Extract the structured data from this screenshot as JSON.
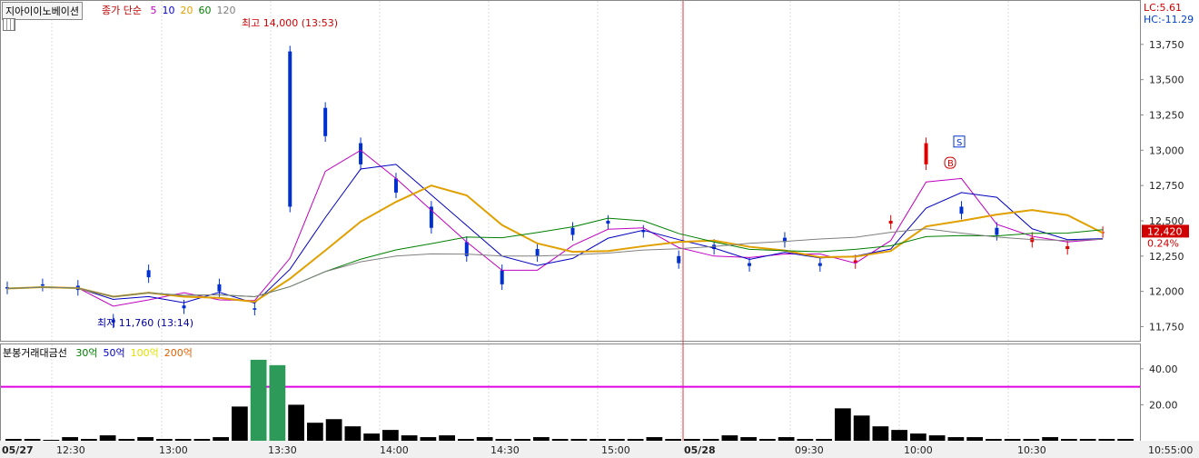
{
  "stock_name": "지아이이노베이션",
  "price_legend": {
    "label": "종가 단순",
    "periods": [
      {
        "text": "5",
        "color": "#c000c0"
      },
      {
        "text": "10",
        "color": "#0000c0"
      },
      {
        "text": "20",
        "color": "#e0a000"
      },
      {
        "text": "60",
        "color": "#008000"
      },
      {
        "text": "120",
        "color": "#808080"
      }
    ]
  },
  "volume_legend": {
    "label": "분봉거래대금선",
    "items": [
      {
        "text": "30억",
        "color": "#008000"
      },
      {
        "text": "50억",
        "color": "#0000c0"
      },
      {
        "text": "100억",
        "color": "#e0e000"
      },
      {
        "text": "200억",
        "color": "#e06000"
      }
    ]
  },
  "top_right": {
    "lc": "LC:5.61",
    "hc": "HC:-11.29"
  },
  "current": {
    "price": "12,420",
    "change": "0.24%"
  },
  "annotations": {
    "high": "최고 14,000 (13:53)",
    "low": "최저 11,760 (13:14)"
  },
  "markers": {
    "buy": "B",
    "sell": "S"
  },
  "chart_data": {
    "type": "candlestick",
    "price_axis": {
      "ticks": [
        "13,750",
        "13,500",
        "13,250",
        "13,000",
        "12,750",
        "12,500",
        "12,250",
        "12,000",
        "11,750"
      ],
      "ylim": [
        11650,
        14000
      ]
    },
    "volume_axis": {
      "ticks": [
        "40.00",
        "20.00"
      ],
      "ylim": [
        0,
        50
      ]
    },
    "x_labels": [
      "05/27",
      "12:30",
      "13:00",
      "13:30",
      "14:00",
      "14:30",
      "15:00",
      "05/28",
      "09:30",
      "10:00",
      "10:30",
      "10:55:00"
    ],
    "price_path": [
      [
        12030,
        12020
      ],
      [
        12050,
        12040
      ],
      [
        12040,
        12010
      ],
      [
        11800,
        11780
      ],
      [
        12150,
        12100
      ],
      [
        11900,
        11880
      ],
      [
        12050,
        12000
      ],
      [
        11880,
        11870
      ],
      [
        13700,
        12600
      ],
      [
        13300,
        13100
      ],
      [
        13050,
        12900
      ],
      [
        12800,
        12700
      ],
      [
        12600,
        12450
      ],
      [
        12350,
        12250
      ],
      [
        12150,
        12050
      ],
      [
        12300,
        12250
      ],
      [
        12450,
        12400
      ],
      [
        12500,
        12480
      ],
      [
        12430,
        12420
      ],
      [
        12250,
        12200
      ],
      [
        12330,
        12300
      ],
      [
        12200,
        12180
      ],
      [
        12380,
        12350
      ],
      [
        12200,
        12180
      ],
      [
        12200,
        12220
      ],
      [
        12480,
        12500
      ],
      [
        12900,
        13050
      ],
      [
        12600,
        12550
      ],
      [
        12450,
        12400
      ],
      [
        12350,
        12380
      ],
      [
        12300,
        12320
      ],
      [
        12420,
        12420
      ]
    ],
    "volume_bars": [
      1,
      1,
      0.5,
      2,
      1,
      3,
      1,
      2,
      1,
      1,
      1,
      2,
      19,
      45,
      42,
      20,
      10,
      12,
      8,
      4,
      6,
      3,
      2,
      3,
      1,
      2,
      1,
      1,
      2,
      1,
      1,
      1,
      1,
      1,
      2,
      1,
      1,
      1,
      3,
      2,
      1,
      2,
      1,
      1,
      18,
      14,
      8,
      6,
      4,
      3,
      2,
      2,
      1,
      1,
      1,
      2,
      1,
      1,
      1,
      1
    ],
    "volume_threshold_line": 30
  }
}
